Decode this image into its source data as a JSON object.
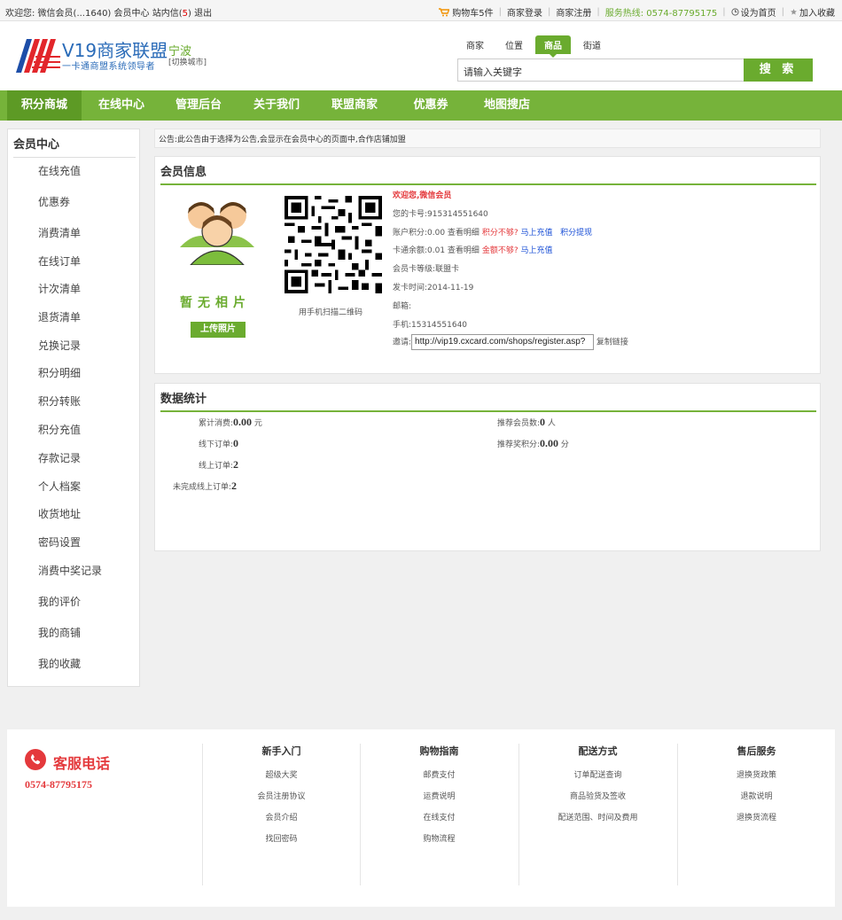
{
  "topbar": {
    "welcome": "欢迎您: 微信会员(...1640)",
    "member_center": "会员中心",
    "inbox": "站内信(",
    "inbox_count": "5",
    "inbox_close": ")",
    "logout": "退出",
    "cart": "购物车5件",
    "merchant_login": "商家登录",
    "merchant_register": "商家注册",
    "hotline": "服务热线: 0574-87795175",
    "set_home": "设为首页",
    "add_favorite": "加入收藏"
  },
  "header": {
    "logo_title": "V19商家联盟",
    "logo_subtitle": "一卡通商盟系统领导者",
    "city": "宁波",
    "city_switch": "[切换城市]",
    "search_tabs": [
      "商家",
      "位置",
      "商品",
      "街道"
    ],
    "search_active": "商品",
    "search_value": "请输入关键字",
    "search_button": "搜 索"
  },
  "nav": [
    "积分商城",
    "在线中心",
    "管理后台",
    "关于我们",
    "联盟商家",
    "优惠券",
    "地图搜店"
  ],
  "sidebar": {
    "title": "会员中心",
    "items": [
      "在线充值",
      "优惠券",
      "消费清单",
      "在线订单",
      "计次清单",
      "退货清单",
      "兑换记录",
      "积分明细",
      "积分转账",
      "积分充值",
      "存款记录",
      "个人档案",
      "收货地址",
      "密码设置",
      "消费中奖记录",
      "我的评价",
      "我的商铺",
      "我的收藏"
    ]
  },
  "notice": "公告:此公告由于选择为公告,会显示在会员中心的页面中,合作店铺加盟",
  "member_info": {
    "title": "会员信息",
    "no_photo": "暂无相片",
    "upload_button": "上传照片",
    "qr_caption": "用手机扫描二维码",
    "welcome": "欢迎您,微信会员",
    "card_no": "您的卡号:915314551640",
    "points_prefix": "账户积分:0.00 查看明细",
    "points_low": "积分不够?",
    "points_recharge": "马上充值",
    "points_withdraw": "积分提现",
    "balance_prefix": "卡通余额:0.01 查看明细",
    "balance_low": "金额不够?",
    "balance_recharge": "马上充值",
    "card_level": "会员卡等级:联盟卡",
    "issue_date": "发卡时间:2014-11-19",
    "email": "邮箱:",
    "phone": "手机:15314551640",
    "invite_label": "邀请:",
    "invite_link": "http://vip19.cxcard.com/shops/register.asp?",
    "copy_link": "复制链接"
  },
  "stats": {
    "title": "数据统计",
    "total_consume_label": "累计消费:",
    "total_consume_value": "0.00",
    "total_consume_unit": "元",
    "offline_orders_label": "线下订单:",
    "offline_orders_value": "0",
    "online_orders_label": "线上订单:",
    "online_orders_value": "2",
    "unfinished_orders_label": "未完成线上订单:",
    "unfinished_orders_value": "2",
    "referred_members_label": "推荐会员数:",
    "referred_members_value": "0",
    "referred_members_unit": "人",
    "referral_points_label": "推荐奖积分:",
    "referral_points_value": "0.00",
    "referral_points_unit": "分"
  },
  "footer": {
    "service_title": "客服电话",
    "service_phone": "0574-87795175",
    "columns": [
      {
        "title": "新手入门",
        "links": [
          "超级大奖",
          "会员注册协议",
          "会员介绍",
          "找回密码"
        ]
      },
      {
        "title": "购物指南",
        "links": [
          "邮费支付",
          "运费说明",
          "在线支付",
          "购物流程"
        ]
      },
      {
        "title": "配送方式",
        "links": [
          "订单配送查询",
          "商品验货及签收",
          "配送范围、时间及费用"
        ]
      },
      {
        "title": "售后服务",
        "links": [
          "退换货政策",
          "退款说明",
          "退换货流程"
        ]
      }
    ]
  },
  "colors": {
    "accent": "#76b33a",
    "accent_dark": "#5d9a25",
    "red": "#e4393c",
    "link_blue": "#1a4fd6"
  }
}
